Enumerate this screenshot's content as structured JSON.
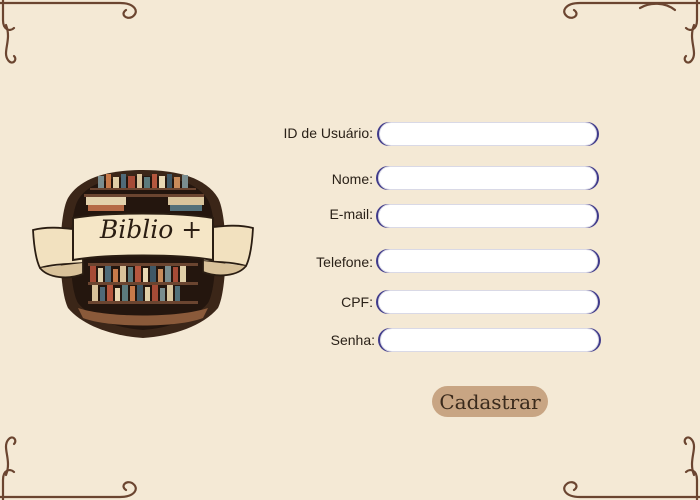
{
  "logo": {
    "text": "Biblio +"
  },
  "form": {
    "fields": [
      {
        "label": "ID de Usuário:",
        "value": "",
        "placeholder": ""
      },
      {
        "label": "Nome:",
        "value": "",
        "placeholder": ""
      },
      {
        "label": "E-mail:",
        "value": "",
        "placeholder": ""
      },
      {
        "label": "Telefone:",
        "value": "",
        "placeholder": ""
      },
      {
        "label": "CPF:",
        "value": "",
        "placeholder": ""
      },
      {
        "label": "Senha:",
        "value": "",
        "placeholder": ""
      }
    ],
    "submit_label": "Cadastrar"
  },
  "colors": {
    "background": "#f4e9d5",
    "ornament": "#6b4530",
    "button": "#c8a583",
    "input_accent": "#3f3a8a"
  }
}
